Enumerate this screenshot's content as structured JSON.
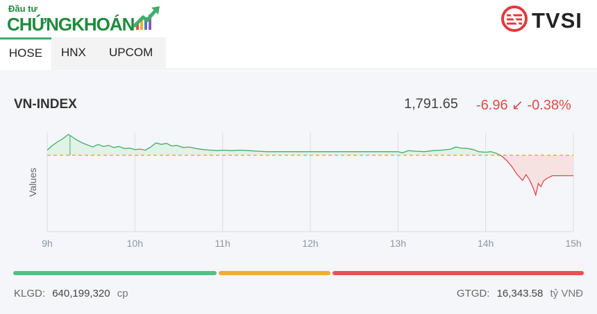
{
  "brand": {
    "small": "Đầu tư",
    "big_a": "CHỨNG",
    "big_b": "KHOÁN",
    "partner": "TVSI"
  },
  "tabs": [
    {
      "label": "HOSE",
      "active": true
    },
    {
      "label": "HNX",
      "active": false
    },
    {
      "label": "UPCOM",
      "active": false
    }
  ],
  "index": {
    "name": "VN-INDEX",
    "value": "1,791.65",
    "change": "-6.96 ↙ -0.38%"
  },
  "chart_data": {
    "type": "area",
    "ylabel": "Values",
    "x_ticks": [
      "9h",
      "10h",
      "11h",
      "12h",
      "13h",
      "14h",
      "15h"
    ],
    "x_range_hours": [
      9,
      15
    ],
    "reference": 1798.61,
    "ylim": [
      1784,
      1803
    ],
    "points": [
      [
        9.0,
        1799.6
      ],
      [
        9.05,
        1800.4
      ],
      [
        9.12,
        1801.2
      ],
      [
        9.18,
        1801.8
      ],
      [
        9.24,
        1802.6
      ],
      [
        9.28,
        1802.2
      ],
      [
        9.33,
        1801.6
      ],
      [
        9.4,
        1801.0
      ],
      [
        9.46,
        1800.6
      ],
      [
        9.52,
        1800.2
      ],
      [
        9.58,
        1800.7
      ],
      [
        9.64,
        1800.3
      ],
      [
        9.7,
        1800.5
      ],
      [
        9.76,
        1800.1
      ],
      [
        9.82,
        1800.3
      ],
      [
        9.88,
        1799.9
      ],
      [
        9.94,
        1800.0
      ],
      [
        10.0,
        1799.7
      ],
      [
        10.06,
        1799.8
      ],
      [
        10.12,
        1799.6
      ],
      [
        10.18,
        1800.2
      ],
      [
        10.24,
        1801.0
      ],
      [
        10.3,
        1800.7
      ],
      [
        10.36,
        1800.9
      ],
      [
        10.42,
        1800.4
      ],
      [
        10.48,
        1800.5
      ],
      [
        10.55,
        1800.1
      ],
      [
        10.62,
        1800.2
      ],
      [
        10.7,
        1799.9
      ],
      [
        10.78,
        1799.7
      ],
      [
        10.86,
        1799.6
      ],
      [
        10.94,
        1799.5
      ],
      [
        11.0,
        1799.6
      ],
      [
        11.1,
        1799.5
      ],
      [
        11.2,
        1799.6
      ],
      [
        11.3,
        1799.5
      ],
      [
        11.4,
        1799.4
      ],
      [
        11.5,
        1799.3
      ],
      [
        11.6,
        1799.3
      ],
      [
        11.7,
        1799.3
      ],
      [
        11.8,
        1799.3
      ],
      [
        11.9,
        1799.3
      ],
      [
        12.0,
        1799.3
      ],
      [
        12.2,
        1799.3
      ],
      [
        12.4,
        1799.3
      ],
      [
        12.6,
        1799.3
      ],
      [
        12.8,
        1799.3
      ],
      [
        13.0,
        1799.3
      ],
      [
        13.05,
        1799.1
      ],
      [
        13.12,
        1799.5
      ],
      [
        13.2,
        1799.4
      ],
      [
        13.3,
        1799.3
      ],
      [
        13.4,
        1799.5
      ],
      [
        13.5,
        1799.6
      ],
      [
        13.6,
        1799.8
      ],
      [
        13.66,
        1800.2
      ],
      [
        13.72,
        1800.0
      ],
      [
        13.8,
        1799.9
      ],
      [
        13.86,
        1799.7
      ],
      [
        13.92,
        1799.3
      ],
      [
        14.0,
        1799.2
      ],
      [
        14.06,
        1799.3
      ],
      [
        14.12,
        1799.0
      ],
      [
        14.18,
        1798.5
      ],
      [
        14.24,
        1797.6
      ],
      [
        14.3,
        1796.4
      ],
      [
        14.36,
        1794.9
      ],
      [
        14.42,
        1793.8
      ],
      [
        14.46,
        1794.9
      ],
      [
        14.5,
        1793.9
      ],
      [
        14.54,
        1792.4
      ],
      [
        14.57,
        1791.0
      ],
      [
        14.6,
        1793.2
      ],
      [
        14.63,
        1792.6
      ],
      [
        14.66,
        1793.7
      ],
      [
        14.7,
        1794.2
      ],
      [
        14.76,
        1794.7
      ],
      [
        14.85,
        1794.7
      ],
      [
        15.0,
        1794.7
      ]
    ]
  },
  "breadth": {
    "colors": {
      "up": "#52c084",
      "flat": "#f0ac36",
      "down": "#e55353"
    },
    "up_fraction": 0.36,
    "flat_fraction": 0.2,
    "down_fraction": 0.44
  },
  "footer": {
    "klgd_label": "KLGD:",
    "klgd_value": "640,199,320",
    "klgd_unit": "cp",
    "gtgd_label": "GTGD:",
    "gtgd_value": "16,343.58",
    "gtgd_unit": "tỷ VNĐ"
  }
}
